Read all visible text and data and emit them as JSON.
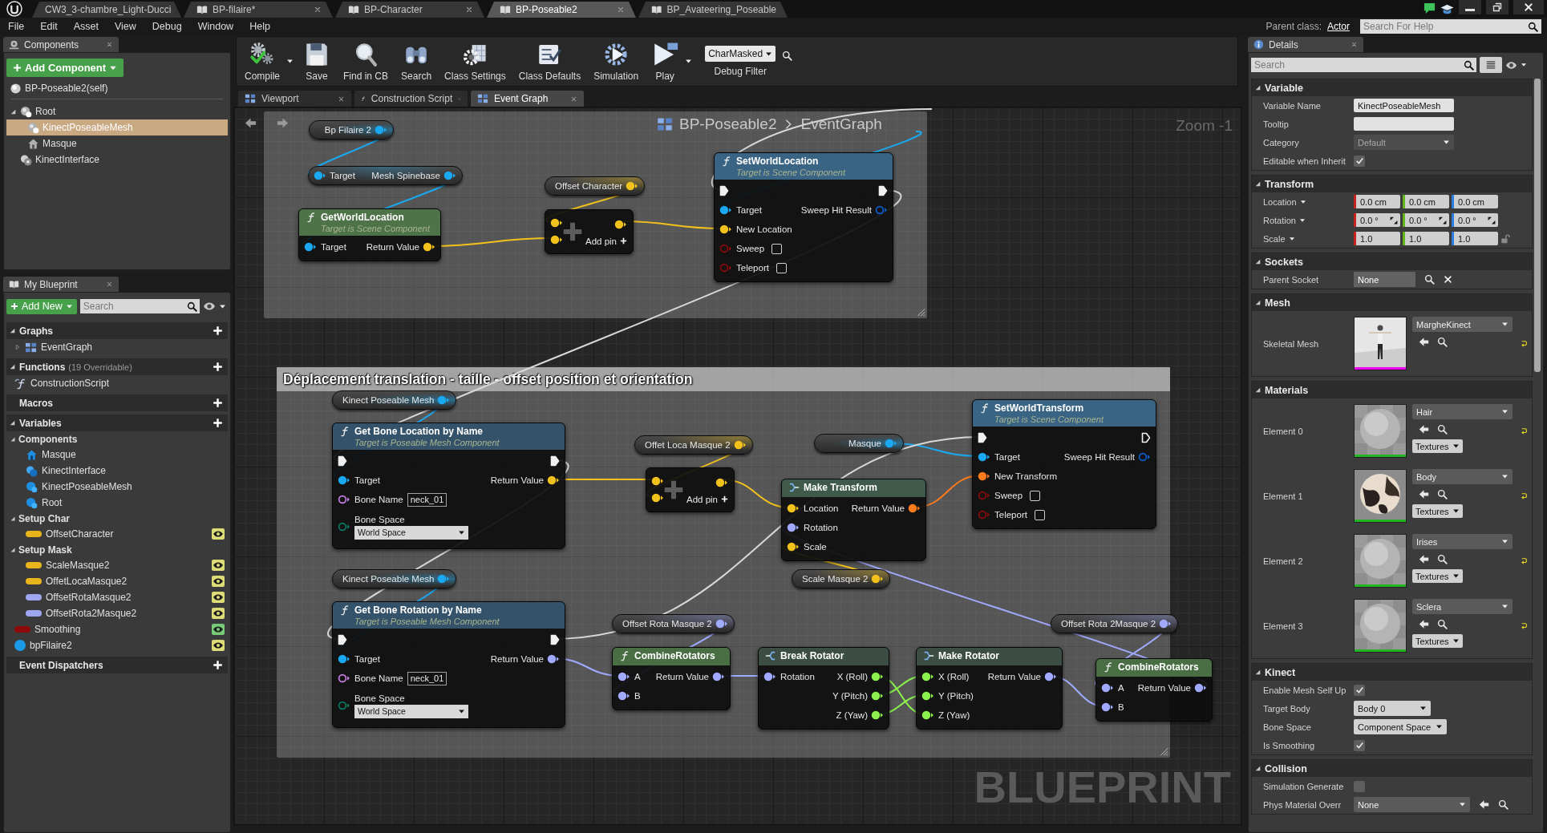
{
  "window": {
    "doc_tabs": [
      {
        "label": "CW3_3-chambre_Light-Ducci",
        "kind": "map",
        "selected": false,
        "closable": false
      },
      {
        "label": "BP-filaire*",
        "kind": "blueprint",
        "selected": false,
        "closable": true
      },
      {
        "label": "BP-Character",
        "kind": "blueprint",
        "selected": false,
        "closable": true
      },
      {
        "label": "BP-Poseable2",
        "kind": "blueprint",
        "selected": true,
        "closable": true
      },
      {
        "label": "BP_Avateering_Poseable",
        "kind": "blueprint",
        "selected": false,
        "closable": false
      }
    ],
    "menu": [
      "File",
      "Edit",
      "Asset",
      "View",
      "Debug",
      "Window",
      "Help"
    ],
    "parent_class": {
      "label": "Parent class:",
      "value": "Actor"
    },
    "help_search": {
      "placeholder": "Search For Help"
    }
  },
  "components_panel": {
    "tab": "Components",
    "add_button": "Add Component",
    "items": [
      {
        "label": "BP-Poseable2(self)",
        "kind": "self",
        "selected": false
      },
      {
        "label": "Root",
        "kind": "scene",
        "selected": false,
        "expanded": true,
        "children": [
          {
            "label": "KinectPoseableMesh",
            "kind": "mesh",
            "selected": true
          },
          {
            "label": "Masque",
            "kind": "static-mesh",
            "selected": false
          }
        ]
      },
      {
        "label": "KinectInterface",
        "kind": "interface",
        "selected": false
      }
    ]
  },
  "my_blueprint": {
    "tab": "My Blueprint",
    "add_button": "Add New",
    "search": {
      "placeholder": "Search"
    },
    "sections": [
      {
        "title": "Graphs",
        "expanded": true,
        "items": [
          {
            "label": "EventGraph",
            "kind": "graph",
            "expanded": false
          }
        ]
      },
      {
        "title": "Functions",
        "note": "(19 Overridable)",
        "expanded": true,
        "items": [
          {
            "label": "ConstructionScript",
            "kind": "function"
          }
        ]
      },
      {
        "title": "Macros"
      },
      {
        "title": "Variables",
        "expanded": true,
        "categories": [
          {
            "title": "Components",
            "expanded": true,
            "items": [
              {
                "label": "Masque",
                "kind": "static-mesh"
              },
              {
                "label": "KinectInterface",
                "kind": "interface"
              },
              {
                "label": "KinectPoseableMesh",
                "kind": "mesh"
              },
              {
                "label": "Root",
                "kind": "scene"
              }
            ]
          },
          {
            "title": "Setup Char",
            "expanded": true,
            "items": [
              {
                "label": "OffsetCharacter",
                "kind": "variable",
                "color": "#e8b41c",
                "eye": {
                  "color": "#dcdc78"
                }
              }
            ]
          },
          {
            "title": "Setup Mask",
            "expanded": true,
            "items": [
              {
                "label": "ScaleMasque2",
                "kind": "variable",
                "color": "#e8b41c",
                "eye": {
                  "color": "#dcdc78"
                }
              },
              {
                "label": "OffetLocaMasque2",
                "kind": "variable",
                "color": "#e8b41c",
                "eye": {
                  "color": "#dcdc78"
                }
              },
              {
                "label": "OffsetRotaMasque2",
                "kind": "variable",
                "color": "#9ea6f0",
                "eye": {
                  "color": "#dcdc78"
                }
              },
              {
                "label": "OffsetRota2Masque2",
                "kind": "variable",
                "color": "#9ea6f0",
                "eye": {
                  "color": "#dcdc78"
                }
              }
            ]
          }
        ],
        "items": [
          {
            "label": "Smoothing",
            "kind": "variable",
            "color": "#8c0a0a",
            "eye": {
              "color": "#78cc78"
            }
          },
          {
            "label": "bpFilaire2",
            "kind": "object",
            "color": "#1a9ae6",
            "eye": {
              "color": "#dcdc78"
            }
          }
        ]
      },
      {
        "title": "Event Dispatchers"
      }
    ]
  },
  "toolbar": {
    "buttons": [
      {
        "label": "Compile",
        "kind": "compile",
        "menu": true
      },
      {
        "label": "Save",
        "kind": "save",
        "menu": false
      },
      {
        "label": "Find in CB",
        "kind": "find",
        "menu": false
      },
      {
        "label": "Search",
        "kind": "search",
        "menu": false
      },
      {
        "label": "Class Settings",
        "kind": "settings",
        "menu": false
      },
      {
        "label": "Class Defaults",
        "kind": "defaults",
        "menu": false
      },
      {
        "label": "Simulation",
        "kind": "simulation",
        "menu": false
      },
      {
        "label": "Play",
        "kind": "play",
        "menu": true
      }
    ],
    "debug_filter": {
      "value": "CharMasked",
      "label": "Debug Filter"
    }
  },
  "graph_tabs": [
    {
      "label": "Viewport",
      "kind": "viewport",
      "selected": false
    },
    {
      "label": "Construction Script",
      "kind": "function",
      "selected": false
    },
    {
      "label": "Event Graph",
      "kind": "graph",
      "selected": true
    }
  ],
  "graph": {
    "breadcrumb": [
      "BP-Poseable2",
      "EventGraph"
    ],
    "zoom": "Zoom -1",
    "watermark": "BLUEPRINT",
    "comments": [
      {
        "kind": "box"
      },
      {
        "kind": "box",
        "title": "Déplacement translation - taille - offset position et orientation"
      }
    ],
    "nodes": [
      {
        "kind": "variable",
        "label": "Bp Filaire 2",
        "pin": {
          "kind": "object",
          "connected": true
        }
      },
      {
        "kind": "compact",
        "rows": [
          {
            "in": {
              "kind": "object",
              "label": "Target",
              "connected": true
            },
            "out": {
              "kind": "object",
              "label": "Mesh Spinebase",
              "connected": true
            }
          }
        ]
      },
      {
        "kind": "function",
        "color": "#4e7348",
        "title": "GetWorldLocation",
        "subtitle": "Target is Scene Component",
        "rows": [
          {
            "in": {
              "kind": "object",
              "label": "Target",
              "connected": true
            },
            "out": {
              "kind": "vector",
              "label": "Return Value",
              "connected": true
            }
          }
        ]
      },
      {
        "kind": "variable",
        "label": "Offset Character",
        "pin": {
          "kind": "vector",
          "connected": true
        }
      },
      {
        "kind": "add",
        "add_pin": "Add pin",
        "rows": [
          {
            "in": {
              "kind": "vector",
              "connected": true
            },
            "out": {
              "kind": "vector",
              "connected": true
            }
          },
          {
            "in": {
              "kind": "vector",
              "connected": true
            }
          }
        ]
      },
      {
        "kind": "function",
        "color": "#3a6484",
        "title": "SetWorldLocation",
        "subtitle": "Target is Scene Component",
        "rows": [
          {
            "in": {
              "kind": "exec",
              "connected": true
            },
            "out": {
              "kind": "exec",
              "connected": true
            }
          },
          {
            "in": {
              "kind": "object",
              "label": "Target",
              "connected": true
            },
            "out": {
              "kind": "struct",
              "label": "Sweep Hit Result",
              "connected": false
            }
          },
          {
            "in": {
              "kind": "vector",
              "label": "New Location",
              "connected": true
            }
          },
          {
            "in": {
              "kind": "bool",
              "label": "Sweep",
              "connected": false,
              "checked": false
            }
          },
          {
            "in": {
              "kind": "bool",
              "label": "Teleport",
              "connected": false,
              "checked": false
            }
          }
        ]
      },
      {
        "kind": "variable",
        "label": "Kinect Poseable Mesh",
        "pin": {
          "kind": "object",
          "connected": true
        }
      },
      {
        "kind": "function",
        "color": "#34536a",
        "title": "Get Bone Location by Name",
        "subtitle": "Target is Poseable Mesh Component",
        "rows": [
          {
            "in": {
              "kind": "exec",
              "connected": true
            },
            "out": {
              "kind": "exec",
              "connected": true
            }
          },
          {
            "in": {
              "kind": "object",
              "label": "Target",
              "connected": true
            },
            "out": {
              "kind": "vector",
              "label": "Return Value",
              "connected": true
            }
          },
          {
            "in": {
              "kind": "name",
              "label": "Bone Name",
              "connected": false,
              "value": "neck_01"
            }
          },
          {
            "in": {
              "kind": "enum",
              "label": "Bone Space",
              "connected": false,
              "dropdown": "World Space"
            }
          }
        ]
      },
      {
        "kind": "variable",
        "label": "Offet Loca Masque 2",
        "pin": {
          "kind": "vector",
          "connected": true
        }
      },
      {
        "kind": "add",
        "add_pin": "Add pin",
        "rows": [
          {
            "in": {
              "kind": "vector",
              "connected": true
            },
            "out": {
              "kind": "vector",
              "connected": true
            }
          },
          {
            "in": {
              "kind": "vector",
              "connected": true
            }
          }
        ]
      },
      {
        "kind": "variable",
        "label": "Masque",
        "pin": {
          "kind": "object",
          "connected": true
        }
      },
      {
        "kind": "make",
        "color": "#3f5a4a",
        "title": "Make Transform",
        "rows": [
          {
            "in": {
              "kind": "vector",
              "label": "Location",
              "connected": true
            },
            "out": {
              "kind": "transform",
              "label": "Return Value",
              "connected": true
            }
          },
          {
            "in": {
              "kind": "rotator",
              "label": "Rotation",
              "connected": true
            }
          },
          {
            "in": {
              "kind": "vector",
              "label": "Scale",
              "connected": true
            }
          }
        ]
      },
      {
        "kind": "function",
        "color": "#3a6484",
        "title": "SetWorldTransform",
        "subtitle": "Target is Scene Component",
        "rows": [
          {
            "in": {
              "kind": "exec",
              "connected": true
            },
            "out": {
              "kind": "exec",
              "connected": false
            }
          },
          {
            "in": {
              "kind": "object",
              "label": "Target",
              "connected": true
            },
            "out": {
              "kind": "struct",
              "label": "Sweep Hit Result",
              "connected": false
            }
          },
          {
            "in": {
              "kind": "transform",
              "label": "New Transform",
              "connected": true
            }
          },
          {
            "in": {
              "kind": "bool",
              "label": "Sweep",
              "connected": false,
              "checked": false
            }
          },
          {
            "in": {
              "kind": "bool",
              "label": "Teleport",
              "connected": false,
              "checked": false
            }
          }
        ]
      },
      {
        "kind": "variable",
        "label": "Kinect Poseable Mesh",
        "pin": {
          "kind": "object",
          "connected": true
        }
      },
      {
        "kind": "variable",
        "label": "Scale Masque 2",
        "pin": {
          "kind": "vector",
          "connected": true
        }
      },
      {
        "kind": "function",
        "color": "#34536a",
        "title": "Get Bone Rotation by Name",
        "subtitle": "Target is Poseable Mesh Component",
        "rows": [
          {
            "in": {
              "kind": "exec",
              "connected": true
            },
            "out": {
              "kind": "exec",
              "connected": true
            }
          },
          {
            "in": {
              "kind": "object",
              "label": "Target",
              "connected": true
            },
            "out": {
              "kind": "rotator",
              "label": "Return Value",
              "connected": true
            }
          },
          {
            "in": {
              "kind": "name",
              "label": "Bone Name",
              "connected": false,
              "value": "neck_01"
            }
          },
          {
            "in": {
              "kind": "enum",
              "label": "Bone Space",
              "connected": false,
              "dropdown": "World Space"
            }
          }
        ]
      },
      {
        "kind": "variable",
        "label": "Offset Rota Masque 2",
        "pin": {
          "kind": "rotator",
          "connected": true
        }
      },
      {
        "kind": "function",
        "color": "#4a6e44",
        "title": "CombineRotators",
        "rows": [
          {
            "in": {
              "kind": "rotator",
              "label": "A",
              "connected": true
            },
            "out": {
              "kind": "rotator",
              "label": "Return Value",
              "connected": true
            }
          },
          {
            "in": {
              "kind": "rotator",
              "label": "B",
              "connected": true
            }
          }
        ]
      },
      {
        "kind": "break",
        "color": "#3c4e44",
        "title": "Break Rotator",
        "rows": [
          {
            "in": {
              "kind": "rotator",
              "label": "Rotation",
              "connected": true
            },
            "out": {
              "kind": "float",
              "label": "X (Roll)",
              "connected": true
            }
          },
          {
            "out": {
              "kind": "float",
              "label": "Y (Pitch)",
              "connected": true
            }
          },
          {
            "out": {
              "kind": "float",
              "label": "Z (Yaw)",
              "connected": true
            }
          }
        ]
      },
      {
        "kind": "make",
        "color": "#3c4e44",
        "title": "Make Rotator",
        "rows": [
          {
            "in": {
              "kind": "float",
              "label": "X (Roll)",
              "connected": true
            },
            "out": {
              "kind": "rotator",
              "label": "Return Value",
              "connected": true
            }
          },
          {
            "in": {
              "kind": "float",
              "label": "Y (Pitch)",
              "connected": true
            }
          },
          {
            "in": {
              "kind": "float",
              "label": "Z (Yaw)",
              "connected": true
            }
          }
        ]
      },
      {
        "kind": "variable",
        "label": "Offset Rota 2Masque 2",
        "pin": {
          "kind": "rotator",
          "connected": true
        }
      },
      {
        "kind": "function",
        "color": "#4a6e44",
        "title": "CombineRotators",
        "rows": [
          {
            "in": {
              "kind": "rotator",
              "label": "A",
              "connected": true
            },
            "out": {
              "kind": "rotator",
              "label": "Return Value",
              "connected": true
            }
          },
          {
            "in": {
              "kind": "rotator",
              "label": "B",
              "connected": true
            }
          }
        ]
      }
    ]
  },
  "details": {
    "tab": "Details",
    "search": {
      "placeholder": "Search"
    },
    "sections": [
      {
        "title": "Variable",
        "expanded": true,
        "rows": [
          {
            "kind": "text",
            "label": "Variable Name",
            "value": "KinectPoseableMesh"
          },
          {
            "kind": "text",
            "label": "Tooltip"
          },
          {
            "kind": "dropdown",
            "label": "Category",
            "value": "Default",
            "disabled": true
          },
          {
            "kind": "checkbox",
            "label": "Editable when Inherit",
            "checked": true
          }
        ]
      },
      {
        "title": "Transform",
        "expanded": true,
        "rows": [
          {
            "kind": "vector",
            "label": "Location",
            "fields": [
              {
                "value": "0.0 cm",
                "color": "#c8221c"
              },
              {
                "value": "0.0 cm",
                "color": "#64b41c"
              },
              {
                "value": "0.0 cm",
                "color": "#2c7ce0"
              }
            ]
          },
          {
            "kind": "rotator",
            "label": "Rotation",
            "fields": [
              {
                "value": "0.0 °",
                "color": "#c8221c"
              },
              {
                "value": "0.0 °",
                "color": "#64b41c"
              },
              {
                "value": "0.0 °",
                "color": "#2c7ce0"
              }
            ]
          },
          {
            "kind": "scale",
            "label": "Scale",
            "locked": false,
            "fields": [
              {
                "value": "1.0",
                "color": "#c8221c"
              },
              {
                "value": "1.0",
                "color": "#64b41c"
              },
              {
                "value": "1.0",
                "color": "#2c7ce0"
              }
            ]
          }
        ]
      },
      {
        "title": "Sockets",
        "expanded": true,
        "rows": [
          {
            "kind": "socket",
            "label": "Parent Socket",
            "value": "None"
          }
        ]
      },
      {
        "title": "Mesh",
        "expanded": true,
        "rows": [
          {
            "kind": "asset",
            "label": "Skeletal Mesh",
            "value": "MargheKinect",
            "thumbnail": {
              "kind": "figure"
            },
            "color": "#f000f0"
          }
        ]
      },
      {
        "title": "Materials",
        "expanded": true,
        "rows": [
          {
            "kind": "material",
            "label": "Element 0",
            "value": "Hair",
            "thumbnail": {
              "kind": "sphere"
            },
            "color": "#22b422",
            "button": "Textures"
          },
          {
            "kind": "material",
            "label": "Element 1",
            "value": "Body",
            "thumbnail": {
              "kind": "textured-sphere"
            },
            "color": "#22b422",
            "button": "Textures"
          },
          {
            "kind": "material",
            "label": "Element 2",
            "value": "Irises",
            "thumbnail": {
              "kind": "sphere"
            },
            "color": "#22b422",
            "button": "Textures"
          },
          {
            "kind": "material",
            "label": "Element 3",
            "value": "Sclera",
            "thumbnail": {
              "kind": "sphere"
            },
            "color": "#22b422",
            "button": "Textures"
          }
        ]
      },
      {
        "title": "Kinect",
        "expanded": true,
        "rows": [
          {
            "kind": "checkbox",
            "label": "Enable Mesh Self Up",
            "checked": true
          },
          {
            "kind": "combo",
            "label": "Target Body",
            "value": "Body 0"
          },
          {
            "kind": "combo",
            "label": "Bone Space",
            "value": "Component Space"
          },
          {
            "kind": "checkbox",
            "label": "Is Smoothing",
            "checked": true
          }
        ]
      },
      {
        "title": "Collision",
        "expanded": true,
        "rows": [
          {
            "kind": "checkbox",
            "label": "Simulation Generate",
            "checked": false
          },
          {
            "kind": "asset-picker",
            "label": "Phys Material Overr",
            "value": "None"
          }
        ]
      }
    ]
  }
}
